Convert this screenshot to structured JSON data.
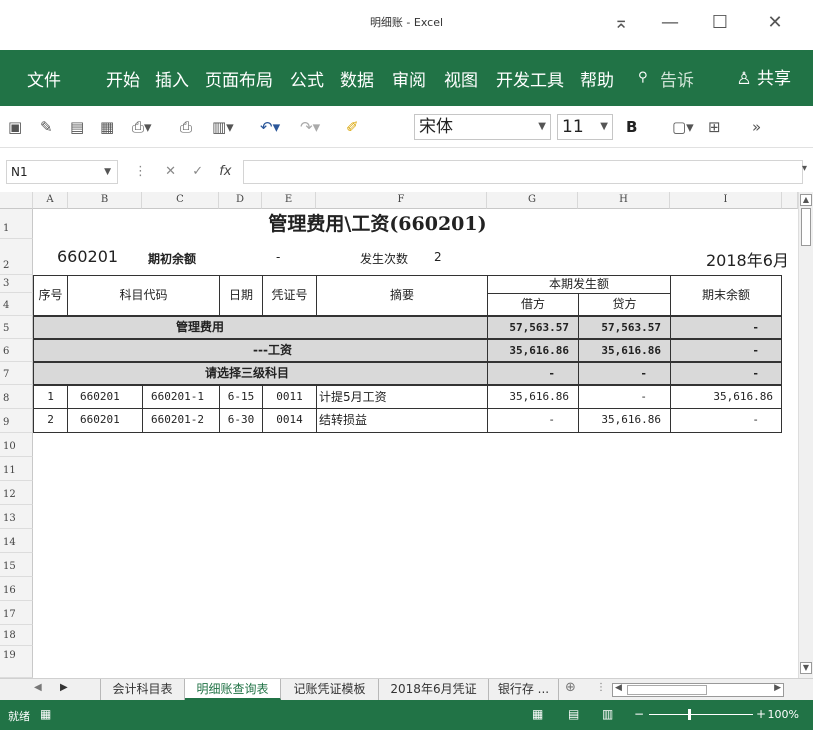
{
  "window": {
    "title": "明细账 - Excel",
    "controls": [
      "⌅",
      "—",
      "☐",
      "✕"
    ]
  },
  "ribbon": {
    "tabs": [
      "文件",
      "开始",
      "插入",
      "页面布局",
      "公式",
      "数据",
      "审阅",
      "视图",
      "开发工具",
      "帮助"
    ],
    "tell_me": "告诉",
    "share": "共享"
  },
  "qat": {
    "font_name": "宋体",
    "font_size": "11",
    "bold_label": "B"
  },
  "formula_bar": {
    "name_box": "N1",
    "fx": "fx",
    "content": ""
  },
  "sheet": {
    "columns": [
      "A",
      "B",
      "C",
      "D",
      "E",
      "F",
      "G",
      "H",
      "I"
    ],
    "rows": [
      "1",
      "2",
      "3",
      "4",
      "5",
      "6",
      "7",
      "8",
      "9",
      "10",
      "11",
      "12",
      "13",
      "14",
      "15",
      "16",
      "17",
      "18",
      "19"
    ],
    "title": "管理费用\\工资(660201)",
    "info": {
      "code": "660201",
      "opening_label": "期初余额",
      "opening_value": "-",
      "count_label": "发生次数",
      "count_value": "2",
      "period": "2018年6月"
    },
    "headers": {
      "seq": "序号",
      "account_code": "科目代码",
      "date": "日期",
      "voucher": "凭证号",
      "summary": "摘要",
      "period_amount": "本期发生额",
      "debit": "借方",
      "credit": "贷方",
      "ending_balance": "期末余额"
    },
    "summary_rows": [
      {
        "label": "管理费用",
        "debit": "57,563.57",
        "credit": "57,563.57",
        "balance": "-"
      },
      {
        "label": "---工资",
        "debit": "35,616.86",
        "credit": "35,616.86",
        "balance": "-"
      },
      {
        "label": "请选择三级科目",
        "debit": "-",
        "credit": "-",
        "balance": "-"
      }
    ],
    "detail_rows": [
      {
        "seq": "1",
        "code": "660201",
        "sub_code": "660201-1",
        "date": "6-15",
        "voucher": "0011",
        "summary": "计提5月工资",
        "debit": "35,616.86",
        "credit": "-",
        "balance": "35,616.86"
      },
      {
        "seq": "2",
        "code": "660201",
        "sub_code": "660201-2",
        "date": "6-30",
        "voucher": "0014",
        "summary": "结转损益",
        "debit": "-",
        "credit": "35,616.86",
        "balance": "-"
      }
    ]
  },
  "sheet_tabs": [
    "会计科目表",
    "明细账查询表",
    "记账凭证模板",
    "2018年6月凭证",
    "银行存 ..."
  ],
  "active_tab": "明细账查询表",
  "status": {
    "ready": "就绪",
    "zoom": "100%"
  },
  "colors": {
    "accent": "#217346",
    "header_fill": "#d9d9d9"
  }
}
